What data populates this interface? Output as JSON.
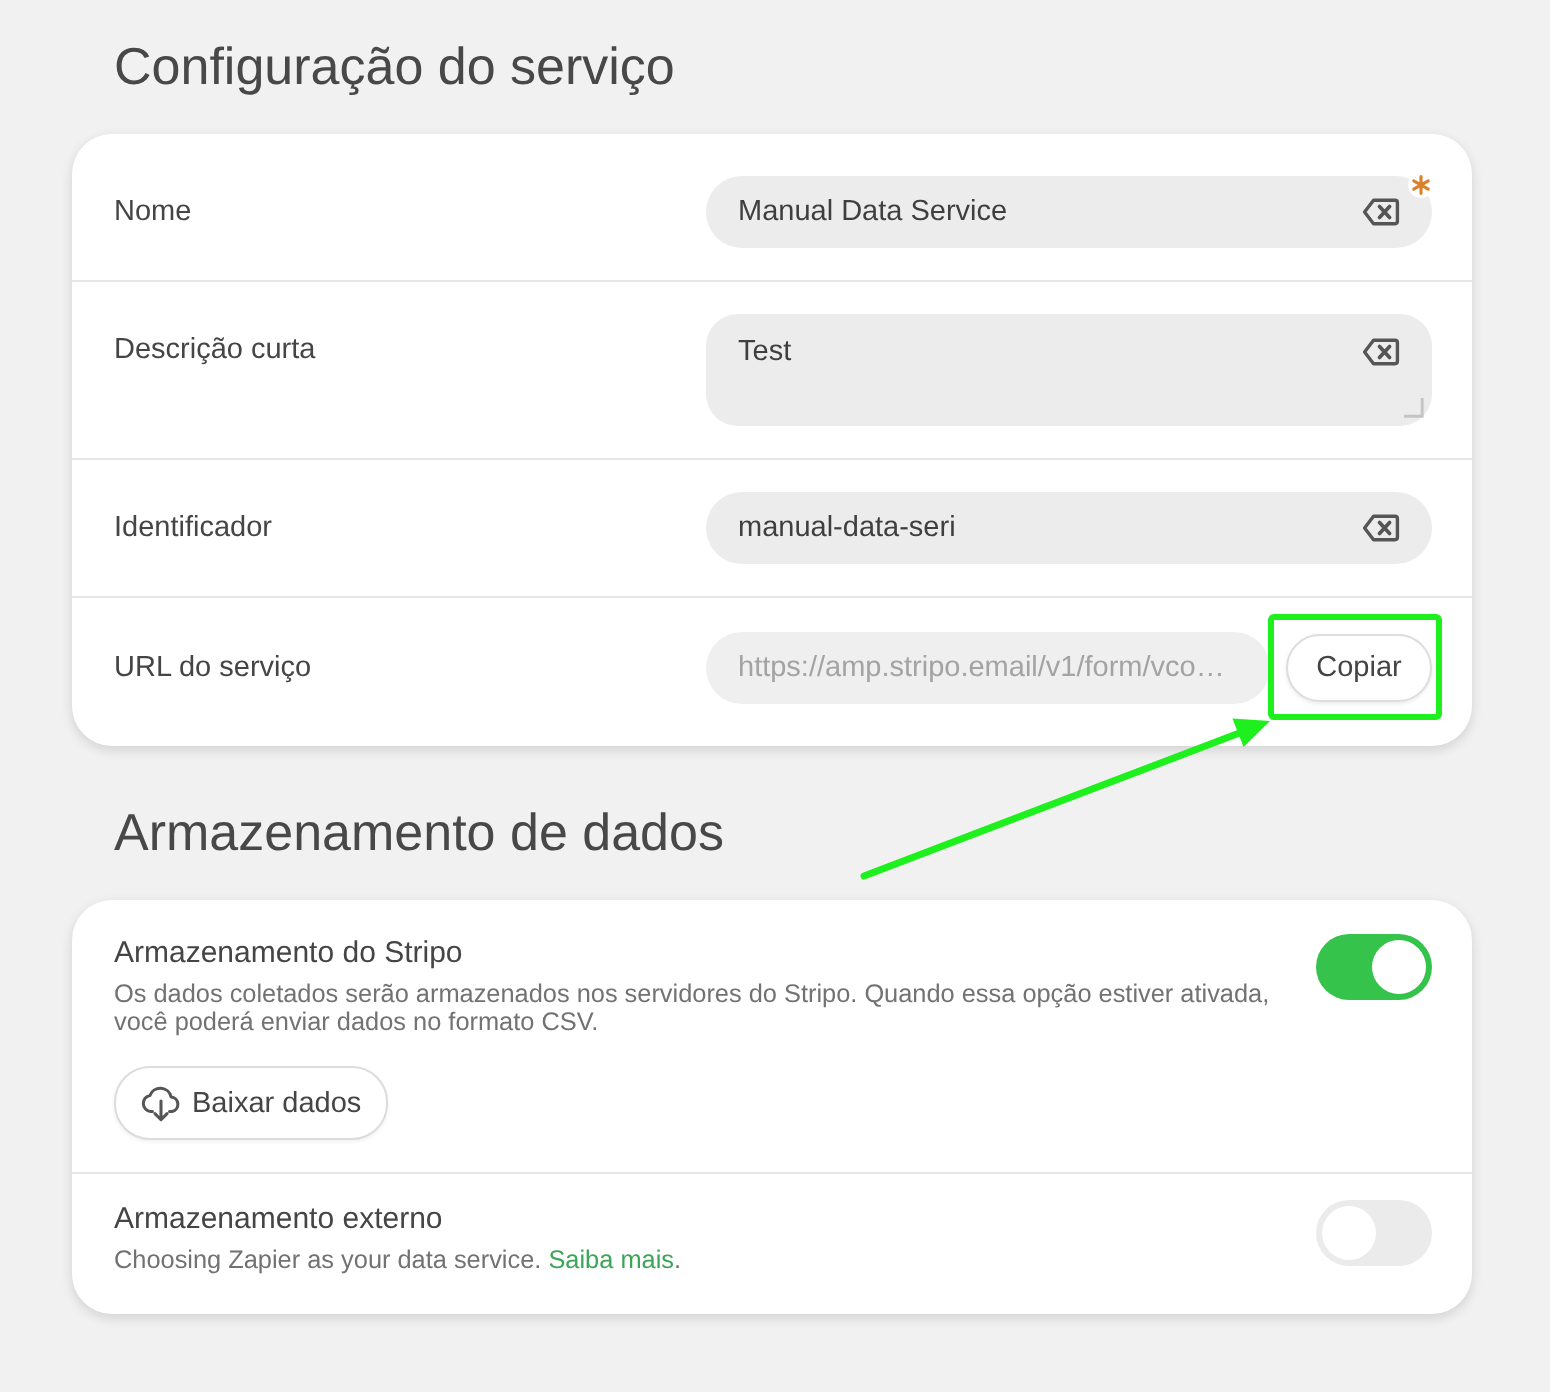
{
  "service_config": {
    "title": "Configuração do serviço",
    "fields": [
      {
        "kind": "input",
        "label": "Nome",
        "value": "Manual Data Service",
        "required": true,
        "clearable": true
      },
      {
        "kind": "textarea",
        "label": "Descrição curta",
        "value": "Test",
        "required": false,
        "clearable": true
      },
      {
        "kind": "input",
        "label": "Identificador",
        "value": "manual-data-seri",
        "required": false,
        "clearable": true
      },
      {
        "kind": "copy",
        "label": "URL do serviço",
        "value": "https://amp.stripo.email/v1/form/vco…",
        "disabled": true,
        "button": {
          "label": "Copiar",
          "highlighted": true
        }
      }
    ]
  },
  "data_storage": {
    "title": "Armazenamento de dados",
    "options": [
      {
        "title": "Armazenamento do Stripo",
        "description": "Os dados coletados serão armazenados nos servidores do Stripo. Quando essa opção estiver ativada, você poderá enviar dados no formato CSV.",
        "on": true,
        "button": {
          "label": "Baixar dados"
        }
      },
      {
        "title": "Armazenamento externo",
        "description": "Choosing Zapier as your data service.",
        "link": "Saiba mais",
        "link_suffix": ".",
        "on": false
      }
    ]
  }
}
